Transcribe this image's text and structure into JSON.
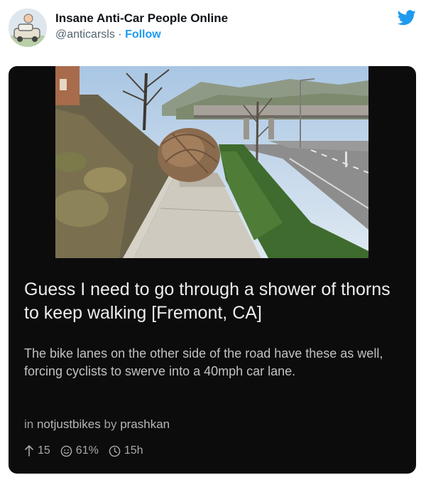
{
  "tweet": {
    "display_name": "Insane Anti-Car People Online",
    "handle": "@anticarsls",
    "separator": "·",
    "follow_label": "Follow"
  },
  "post": {
    "title": "Guess I need to go through a shower of thorns to keep walking [Fremont, CA]",
    "body": "The bike lanes on the other side of the road have these as well, forcing cyclists to swerve into a 40mph car lane.",
    "in_label": "in",
    "subreddit": "notjustbikes",
    "by_label": "by",
    "author": "prashkan",
    "upvotes": "15",
    "upvote_ratio": "61%",
    "age": "15h"
  },
  "icons": {
    "bird": "twitter-bird-icon",
    "upvote": "arrow-up-icon",
    "ratio": "smiley-icon",
    "age": "clock-icon"
  },
  "colors": {
    "accent": "#1d9bf0",
    "card_bg": "#0c0c0c",
    "title_text": "#ededed",
    "body_text": "#c2c2c2"
  }
}
